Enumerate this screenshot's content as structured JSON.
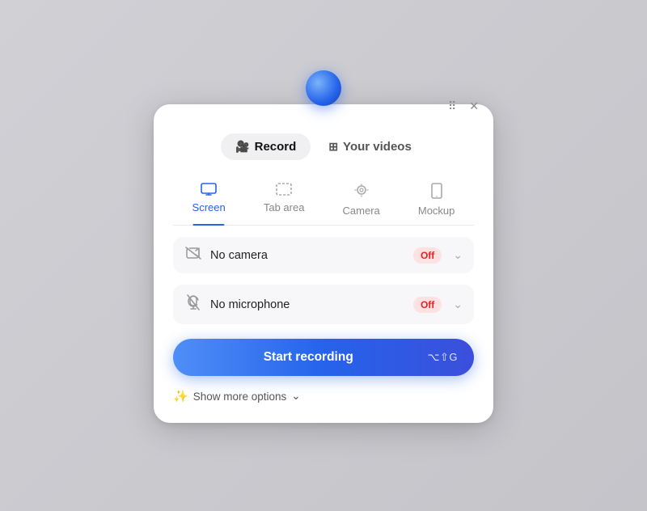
{
  "orb": {},
  "window": {
    "drag_icon": "⠿",
    "close_icon": "✕"
  },
  "top_tabs": [
    {
      "id": "record",
      "label": "Record",
      "icon": "🎥",
      "active": true
    },
    {
      "id": "your-videos",
      "label": "Your videos",
      "icon": "⊞",
      "active": false
    }
  ],
  "nav_tabs": [
    {
      "id": "screen",
      "label": "Screen",
      "active": true
    },
    {
      "id": "tab-area",
      "label": "Tab area",
      "active": false
    },
    {
      "id": "camera",
      "label": "Camera",
      "active": false
    },
    {
      "id": "mockup",
      "label": "Mockup",
      "active": false
    }
  ],
  "devices": [
    {
      "id": "camera",
      "label": "No camera",
      "status": "Off"
    },
    {
      "id": "microphone",
      "label": "No microphone",
      "status": "Off"
    }
  ],
  "start_button": {
    "label": "Start recording",
    "shortcut": "⌥⇧G"
  },
  "more_options": {
    "sparkle": "✨",
    "label": "Show more options",
    "chevron": "⌄"
  }
}
